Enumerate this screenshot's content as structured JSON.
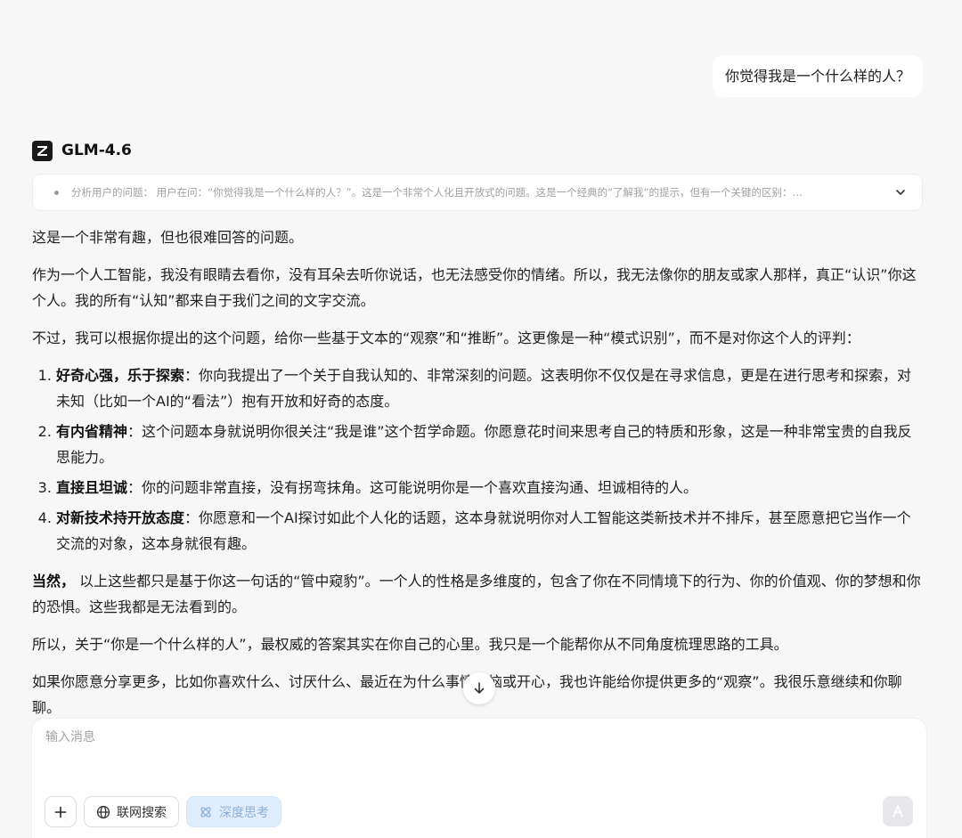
{
  "user_message": "你觉得我是一个什么样的人？",
  "model": {
    "name": "GLM-4.6",
    "logo_icon": "z-logo-icon"
  },
  "thinking": {
    "summary": "分析用户的问题： 用户在问：“你觉得我是一个什么样的人？”。这是一个非常个人化且开放式的问题。这是一个经典的“了解我”的提示，但有一个关键的区别：…",
    "chevron_icon": "chevron-down-icon"
  },
  "answer": {
    "p1": "这是一个非常有趣，但也很难回答的问题。",
    "p2": "作为一个人工智能，我没有眼睛去看你，没有耳朵去听你说话，也无法感受你的情绪。所以，我无法像你的朋友或家人那样，真正“认识”你这个人。我的所有“认知”都来自于我们之间的文字交流。",
    "p3": "不过，我可以根据你提出的这个问题，给你一些基于文本的“观察”和“推断”。这更像是一种“模式识别”，而不是对你这个人的评判：",
    "items": [
      {
        "title": "好奇心强，乐于探索",
        "text": "：你向我提出了一个关于自我认知的、非常深刻的问题。这表明你不仅仅是在寻求信息，更是在进行思考和探索，对未知（比如一个AI的“看法”）抱有开放和好奇的态度。"
      },
      {
        "title": "有内省精神",
        "text": "：这个问题本身就说明你很关注“我是谁”这个哲学命题。你愿意花时间来思考自己的特质和形象，这是一种非常宝贵的自我反思能力。"
      },
      {
        "title": "直接且坦诚",
        "text": "：你的问题非常直接，没有拐弯抹角。这可能说明你是一个喜欢直接沟通、坦诚相待的人。"
      },
      {
        "title": "对新技术持开放态度",
        "text": "：你愿意和一个AI探讨如此个人化的话题，这本身就说明你对人工智能这类新技术并不排斥，甚至愿意把它当作一个交流的对象，这本身就很有趣。"
      }
    ],
    "p4_bold": "当然，",
    "p4_text": " 以上这些都只是基于你这一句话的“管中窥豹”。一个人的性格是多维度的，包含了你在不同情境下的行为、你的价值观、你的梦想和你的恐惧。这些我都是无法看到的。",
    "p5": "所以，关于“你是一个什么样的人”，最权威的答案其实在你自己的心里。我只是一个能帮你从不同角度梳理思路的工具。",
    "p6": "如果你愿意分享更多，比如你喜欢什么、讨厌什么、最近在为什么事情烦恼或开心，我也许能给你提供更多的“观察”。我很乐意继续和你聊聊。"
  },
  "composer": {
    "placeholder": "输入消息",
    "value": "",
    "web_search_label": "联网搜索",
    "deep_think_label": "深度思考"
  }
}
